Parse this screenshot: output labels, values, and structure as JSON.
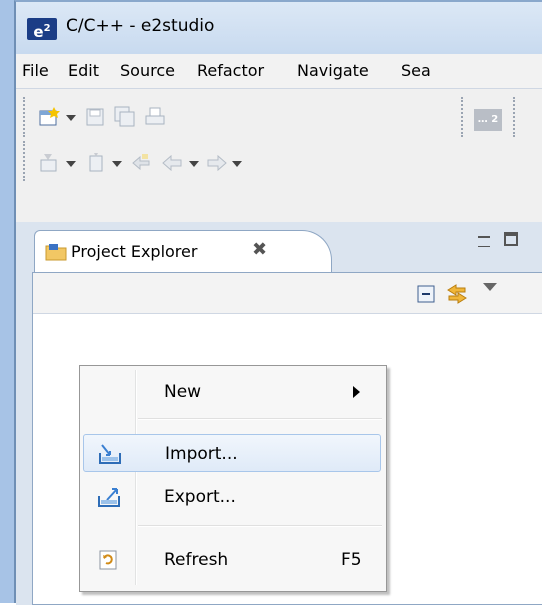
{
  "window": {
    "title": "C/C++ - e2studio",
    "logo_text": "e",
    "logo_sup": "2"
  },
  "menubar": {
    "items": [
      "File",
      "Edit",
      "Source",
      "Refactor",
      "Navigate",
      "Sea"
    ]
  },
  "toolbar": {
    "perspective_label": "… 2"
  },
  "view": {
    "tab_label": "Project Explorer",
    "close_glyph": "✖"
  },
  "context_menu": {
    "new_label": "New",
    "import_label": "Import...",
    "export_label": "Export...",
    "refresh_label": "Refresh",
    "refresh_shortcut": "F5"
  },
  "colors": {
    "accent": "#a7c3e6",
    "highlight": "#dfeaf8",
    "logo": "#1b3d86"
  }
}
